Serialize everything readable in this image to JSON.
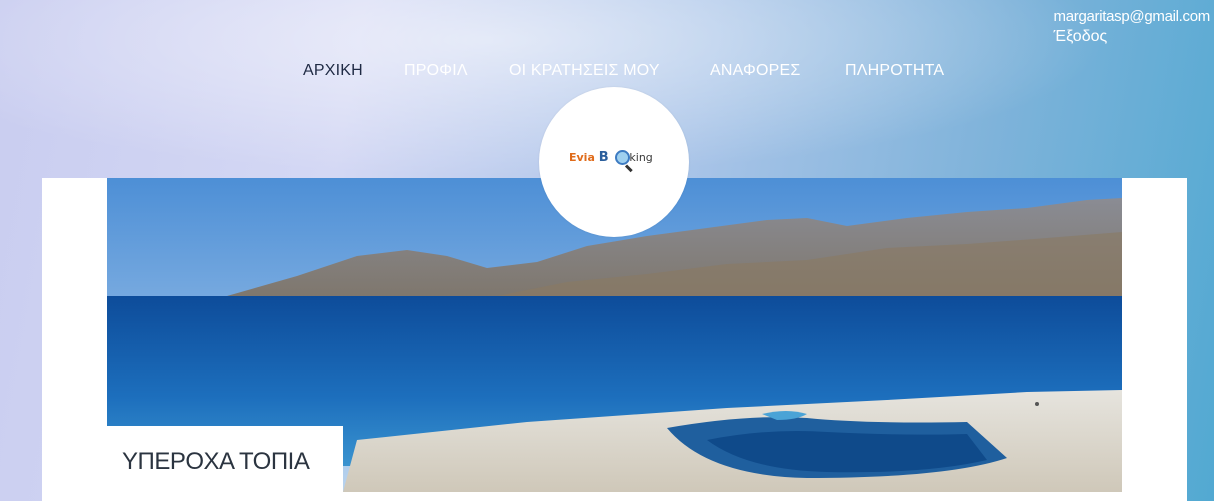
{
  "user": {
    "email": "margaritasp@gmail.com",
    "logout_label": "Έξοδος"
  },
  "nav": {
    "items": [
      {
        "label": "ΑΡΧΙΚΗ",
        "active": true
      },
      {
        "label": "ΠΡΟΦΙΛ",
        "active": false
      },
      {
        "label": "ΟΙ ΚΡΑΤΗΣΕΙΣ ΜΟΥ",
        "active": false
      },
      {
        "label": "ΑΝΑΦΟΡΕΣ",
        "active": false
      },
      {
        "label": "ΠΛΗΡΟΤΗΤΑ",
        "active": false
      }
    ]
  },
  "logo": {
    "part1": "Evia",
    "part2": "B",
    "part3": "oking"
  },
  "hero": {
    "caption": "ΥΠΕΡΟΧΑ ΤΟΠΙΑ"
  },
  "colors": {
    "nav_active": "#1f2a44",
    "nav_inactive": "#ffffff",
    "logo_orange": "#e06b1a",
    "logo_blue": "#2c5f9c"
  }
}
